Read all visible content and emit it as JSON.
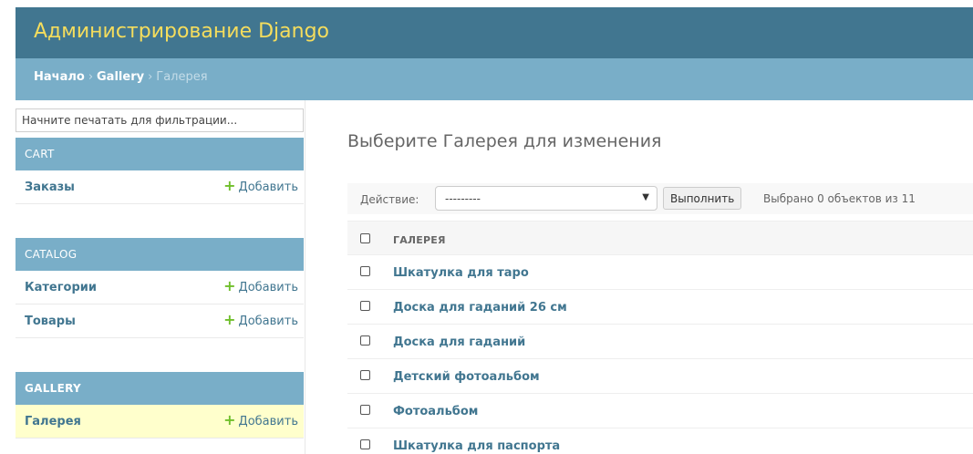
{
  "header": {
    "site_title": "Администрирование Django"
  },
  "breadcrumbs": {
    "home": "Начало",
    "separator": "›",
    "app": "Gallery",
    "current": "Галерея"
  },
  "sidebar": {
    "filter_placeholder": "Начните печатать для фильтрации...",
    "add_label": "Добавить",
    "modules": [
      {
        "caption": "CART",
        "models": [
          {
            "name": "Заказы"
          }
        ]
      },
      {
        "caption": "CATALOG",
        "models": [
          {
            "name": "Категории"
          },
          {
            "name": "Товары"
          }
        ]
      },
      {
        "caption": "GALLERY",
        "models": [
          {
            "name": "Галерея",
            "current": true
          }
        ]
      }
    ]
  },
  "main": {
    "title": "Выберите Галерея для изменения",
    "action_label": "Действие:",
    "action_select_value": "---------",
    "run_button": "Выполнить",
    "selected_count": "Выбрано 0 объектов из 11",
    "column_header": "ГАЛЕРЕЯ",
    "rows": [
      "Шкатулка для таро",
      "Доска для гаданий 26 см",
      "Доска для гаданий",
      "Детский фотоальбом",
      "Фотоальбом",
      "Шкатулка для паспорта"
    ]
  },
  "colors": {
    "header_bg": "#417690",
    "title_yellow": "#f5dd5d",
    "breadcrumb_bg": "#79aec8",
    "link_blue": "#417690",
    "add_plus_green": "#70bf2b",
    "current_row_bg": "#ffffcc"
  },
  "icons": {
    "add": "plus-icon",
    "select": "chevron-down-icon",
    "checkbox": "checkbox-icon"
  }
}
